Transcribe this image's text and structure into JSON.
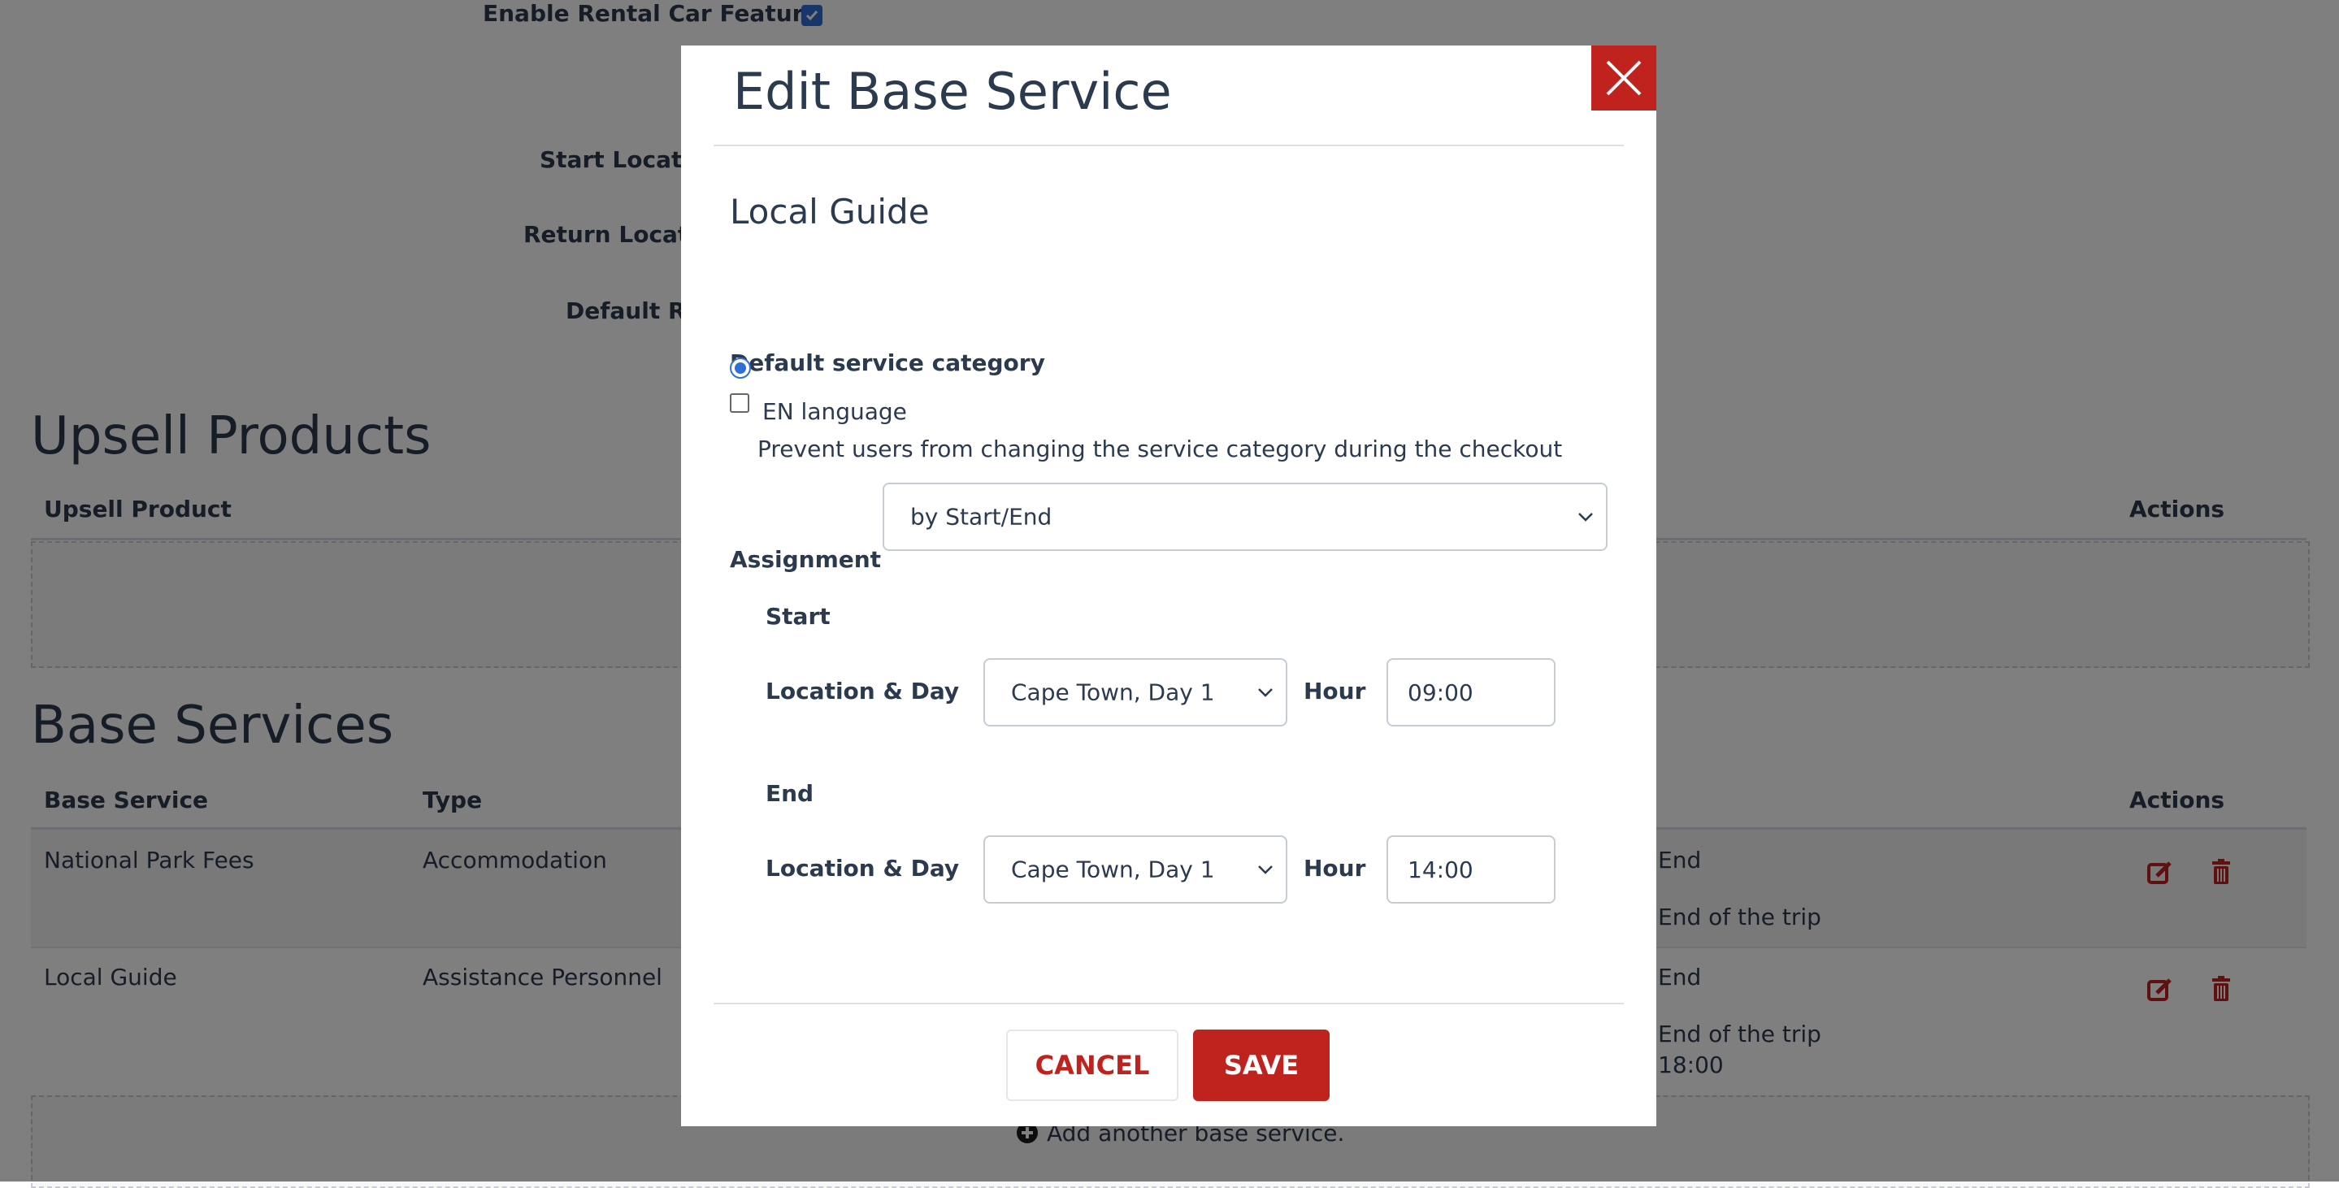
{
  "page": {
    "rental_car_label": "Enable Rental Car Feature",
    "start_location_label": "Start Locatio",
    "return_location_label": "Return Locatio",
    "default_label": "Default Re",
    "upsell_section_title": "Upsell Products",
    "upsell_table": {
      "col_upsell_product": "Upsell Product",
      "col_actions": "Actions"
    },
    "base_section_title": "Base Services",
    "base_table": {
      "col_base_service": "Base Service",
      "col_type": "Type",
      "col_actions": "Actions",
      "rows": [
        {
          "service": "National Park Fees",
          "type": "Accommodation",
          "end_label": "End",
          "end_value": "End of the trip",
          "end_time": ""
        },
        {
          "service": "Local Guide",
          "type": "Assistance Personnel",
          "end_label": "End",
          "end_value": "End of the trip",
          "end_time": "18:00"
        }
      ],
      "add_another": "Add another base service."
    },
    "accent_color": "#c0231e"
  },
  "modal": {
    "title": "Edit Base Service",
    "service_name": "Local Guide",
    "category_label": "Default service category",
    "radio_option": "EN language",
    "prevent_checkbox_label": "Prevent users from changing the service category during the checkout",
    "assignment_label": "Assignment",
    "assignment_value": "by Start/End",
    "start_heading": "Start",
    "end_heading": "End",
    "location_day_label": "Location & Day",
    "hour_label": "Hour",
    "start_location_value": "Cape Town, Day 1",
    "start_hour_value": "09:00",
    "end_location_value": "Cape Town, Day 1",
    "end_hour_value": "14:00",
    "cancel_label": "CANCEL",
    "save_label": "SAVE"
  }
}
